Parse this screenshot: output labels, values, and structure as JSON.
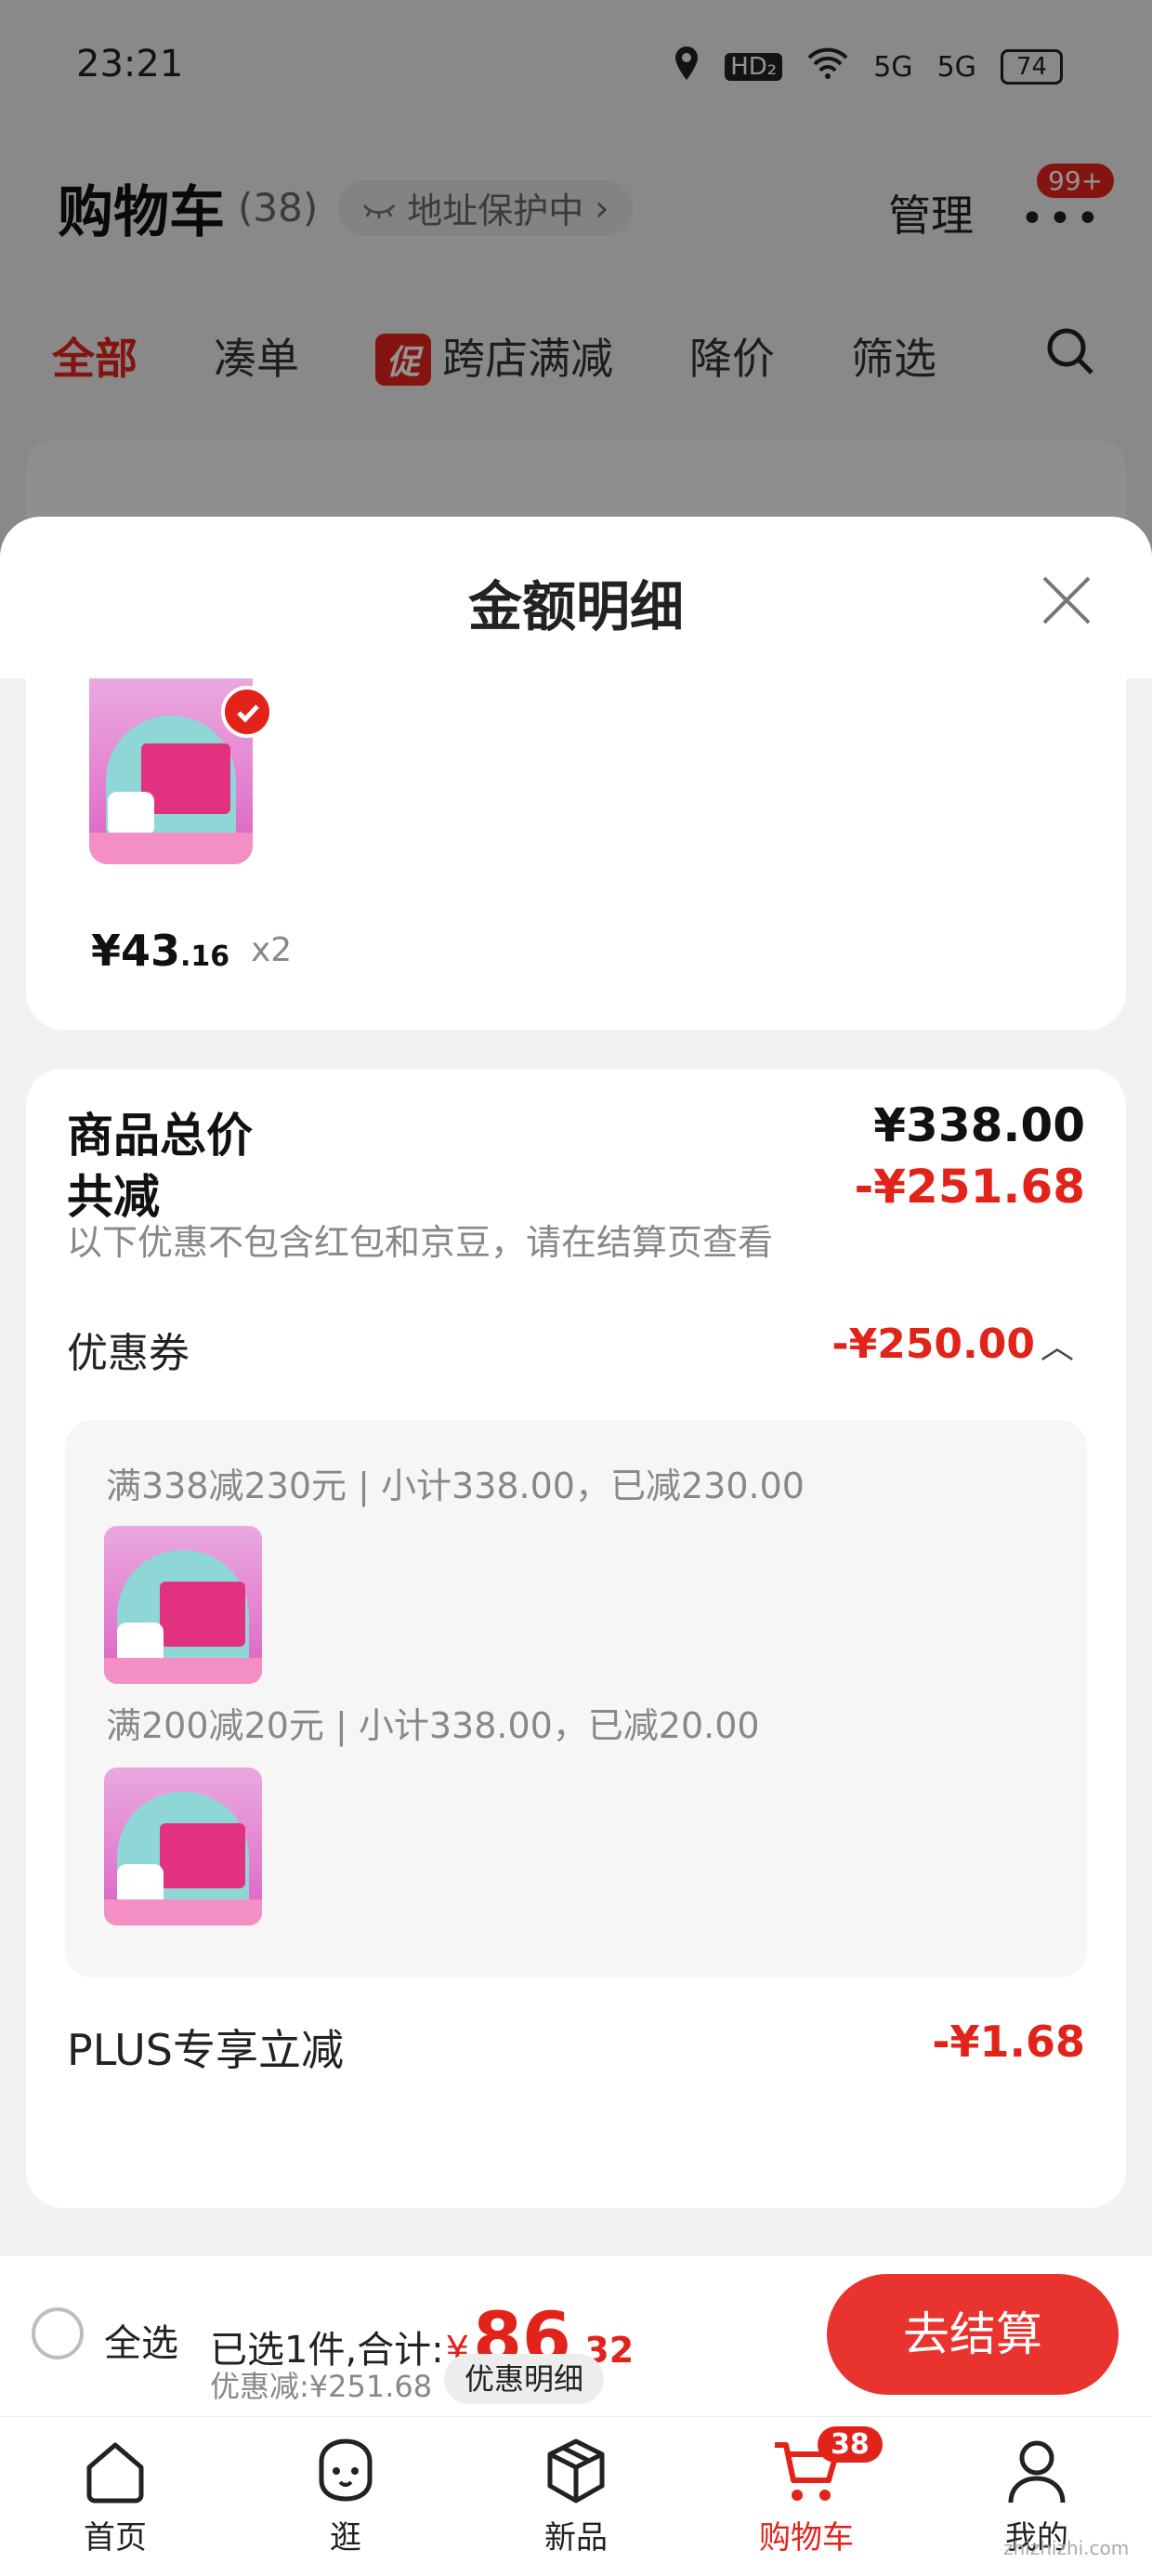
{
  "status_bar": {
    "time": "23:21",
    "hd": "HD₂",
    "signal1": "5G",
    "signal2": "5G",
    "battery": "74"
  },
  "header": {
    "title": "购物车",
    "count": "(38)",
    "address_protect": "地址保护中",
    "manage": "管理",
    "more_badge": "99+"
  },
  "tabs": [
    {
      "label": "全部"
    },
    {
      "label": "凑单"
    },
    {
      "label": "跨店满减",
      "tag": "促"
    },
    {
      "label": "降价"
    },
    {
      "label": "筛选"
    }
  ],
  "sheet": {
    "title": "金额明细",
    "item": {
      "price_int": "¥43",
      "price_dec": ".16",
      "qty": "x2"
    },
    "goods_total_label": "商品总价",
    "goods_total_value": "¥338.00",
    "total_reduce_label": "共减",
    "total_reduce_value": "-¥251.68",
    "note": "以下优惠不包含红包和京豆，请在结算页查看",
    "coupon_label": "优惠券",
    "coupon_value": "-¥250.00",
    "coupon_rules": [
      {
        "text": "满338减230元 | 小计338.00，已减230.00"
      },
      {
        "text": "满200减20元 | 小计338.00，已减20.00"
      }
    ],
    "plus_label": "PLUS专享立减",
    "plus_value": "-¥1.68"
  },
  "checkout": {
    "select_all": "全选",
    "selected_text": "已选1件,合计:",
    "currency": "¥",
    "amount_int": "86",
    "amount_dec": ".32",
    "discount_text": "优惠减:¥251.68",
    "detail_button": "优惠明细",
    "checkout_button": "去结算"
  },
  "bottom_nav": [
    {
      "label": "首页",
      "icon": "home-icon"
    },
    {
      "label": "逛",
      "icon": "browse-icon"
    },
    {
      "label": "新品",
      "icon": "new-product-icon"
    },
    {
      "label": "购物车",
      "icon": "cart-icon",
      "badge": "38",
      "active": true
    },
    {
      "label": "我的",
      "icon": "profile-icon"
    }
  ],
  "watermark": "zhizhizhi.com",
  "colors": {
    "accent": "#e2231a",
    "checkout_button": "#e8332f"
  }
}
